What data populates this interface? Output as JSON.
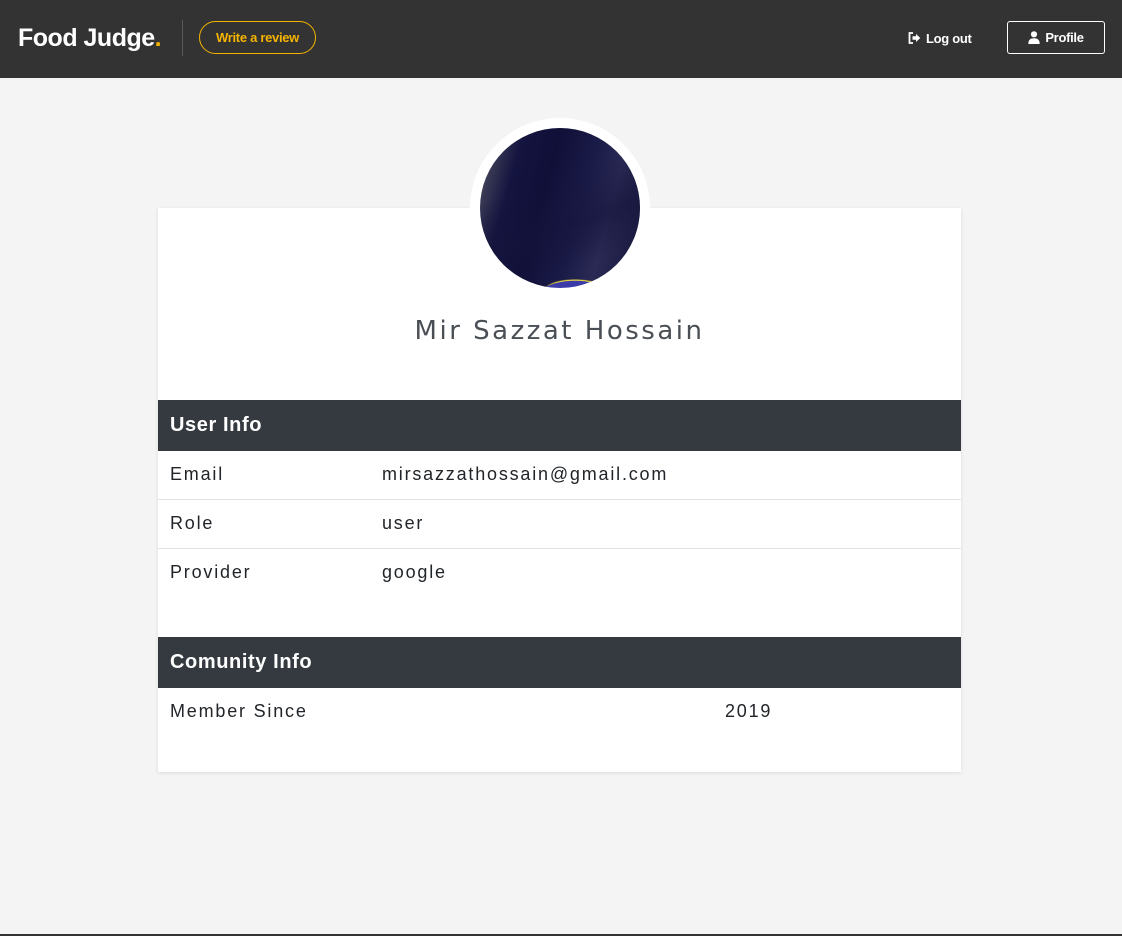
{
  "header": {
    "brand_name": "Food Judge",
    "brand_dot": ".",
    "write_review_label": "Write a review",
    "logout_label": "Log out",
    "profile_label": "Profile",
    "accent_color": "#f5b400",
    "background_color": "#333333"
  },
  "profile": {
    "name": "Mir Sazzat Hossain",
    "avatar": "user-avatar-photo"
  },
  "user_info": {
    "title": "User Info",
    "rows": [
      {
        "label": "Email",
        "value": "mirsazzathossain@gmail.com"
      },
      {
        "label": "Role",
        "value": "user"
      },
      {
        "label": "Provider",
        "value": "google"
      }
    ]
  },
  "community_info": {
    "title": "Comunity Info",
    "rows": [
      {
        "label": "Member Since",
        "value": "2019"
      }
    ]
  },
  "icons": {
    "logout": "sign-out-icon",
    "profile": "user-icon"
  }
}
